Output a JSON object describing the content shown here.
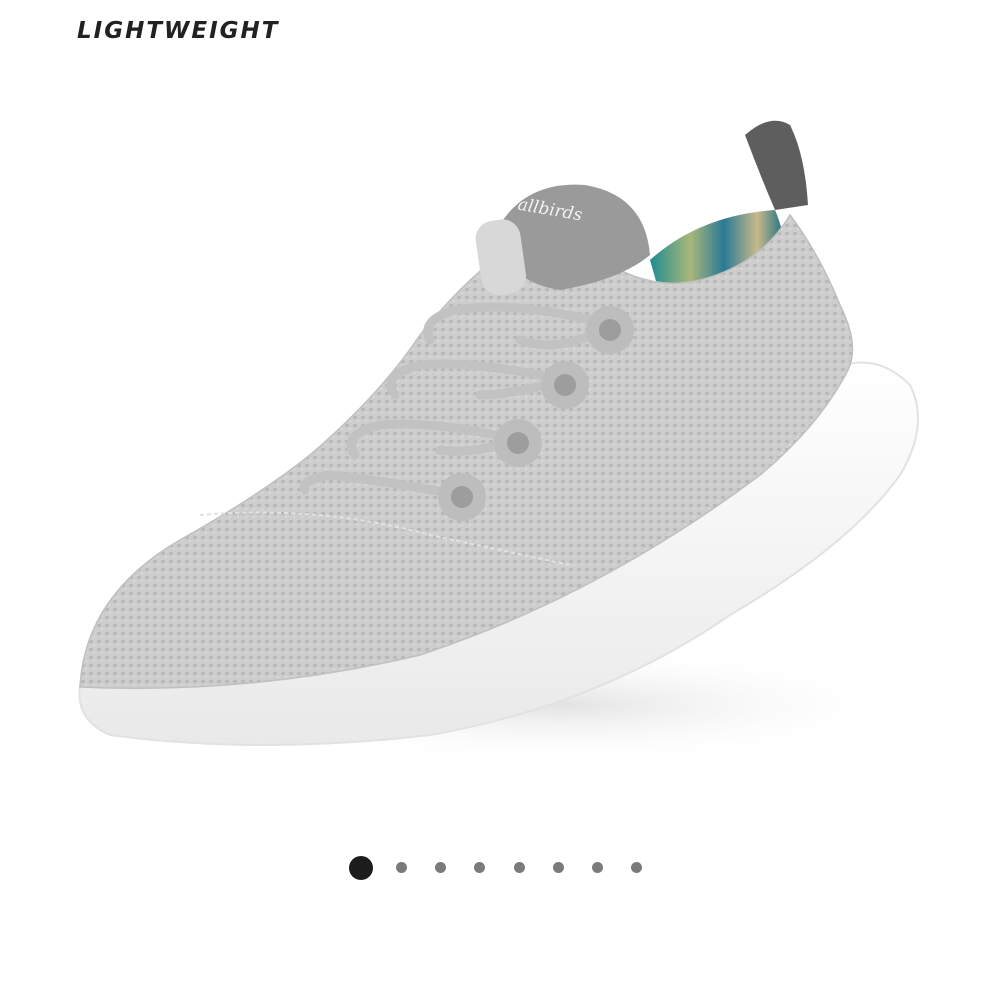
{
  "badge": {
    "label": "LIGHTWEIGHT"
  },
  "product_image": {
    "subject": "light-grey knit sneaker with white sole",
    "brand_mark": "allbirds",
    "colors": {
      "upper": "#c9c9c9",
      "sole": "#f7f7f7",
      "heel_tab": "#5e5e5e",
      "lining": "#1f8c8f"
    }
  },
  "carousel": {
    "active_index": 0,
    "dot_count": 8,
    "active_color": "#1c1c1c",
    "inactive_color": "#7a7a7a"
  }
}
